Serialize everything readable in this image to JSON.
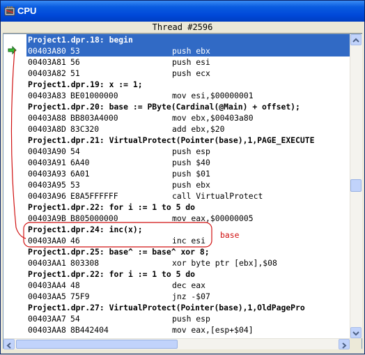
{
  "window": {
    "title": "CPU"
  },
  "thread_header": "Thread #2596",
  "annotation": {
    "label": "base",
    "color": "#d01010"
  },
  "rows": [
    {
      "kind": "src",
      "text": "Project1.dpr.18: begin",
      "selected": true
    },
    {
      "kind": "asm",
      "addr": "00403A80",
      "bytes": "53",
      "instr": "push ebx",
      "selected": true
    },
    {
      "kind": "asm",
      "addr": "00403A81",
      "bytes": "56",
      "instr": "push esi"
    },
    {
      "kind": "asm",
      "addr": "00403A82",
      "bytes": "51",
      "instr": "push ecx"
    },
    {
      "kind": "src",
      "text": "Project1.dpr.19: x := 1;"
    },
    {
      "kind": "asm",
      "addr": "00403A83",
      "bytes": "BE01000000",
      "instr": "mov esi,$00000001"
    },
    {
      "kind": "src",
      "text": "Project1.dpr.20: base := PByte(Cardinal(@Main) + offset);"
    },
    {
      "kind": "asm",
      "addr": "00403A88",
      "bytes": "BB803A4000",
      "instr": "mov ebx,$00403a80"
    },
    {
      "kind": "asm",
      "addr": "00403A8D",
      "bytes": "83C320",
      "instr": "add ebx,$20"
    },
    {
      "kind": "src",
      "text": "Project1.dpr.21: VirtualProtect(Pointer(base),1,PAGE_EXECUTE"
    },
    {
      "kind": "asm",
      "addr": "00403A90",
      "bytes": "54",
      "instr": "push esp"
    },
    {
      "kind": "asm",
      "addr": "00403A91",
      "bytes": "6A40",
      "instr": "push $40"
    },
    {
      "kind": "asm",
      "addr": "00403A93",
      "bytes": "6A01",
      "instr": "push $01"
    },
    {
      "kind": "asm",
      "addr": "00403A95",
      "bytes": "53",
      "instr": "push ebx"
    },
    {
      "kind": "asm",
      "addr": "00403A96",
      "bytes": "E8A5FFFFFF",
      "instr": "call VirtualProtect"
    },
    {
      "kind": "src",
      "text": "Project1.dpr.22: for i := 1 to 5 do"
    },
    {
      "kind": "asm",
      "addr": "00403A9B",
      "bytes": "B805000000",
      "instr": "mov eax,$00000005"
    },
    {
      "kind": "src",
      "text": "Project1.dpr.24: inc(x);"
    },
    {
      "kind": "asm",
      "addr": "00403AA0",
      "bytes": "46",
      "instr": "inc esi"
    },
    {
      "kind": "src",
      "text": "Project1.dpr.25: base^ := base^ xor 8;"
    },
    {
      "kind": "asm",
      "addr": "00403AA1",
      "bytes": "803308",
      "instr": "xor byte ptr [ebx],$08"
    },
    {
      "kind": "src",
      "text": "Project1.dpr.22: for i := 1 to 5 do"
    },
    {
      "kind": "asm",
      "addr": "00403AA4",
      "bytes": "48",
      "instr": "dec eax"
    },
    {
      "kind": "asm",
      "addr": "00403AA5",
      "bytes": "75F9",
      "instr": "jnz -$07"
    },
    {
      "kind": "src",
      "text": "Project1.dpr.27: VirtualProtect(Pointer(base),1,OldPagePro"
    },
    {
      "kind": "asm",
      "addr": "00403AA7",
      "bytes": "54",
      "instr": "push esp"
    },
    {
      "kind": "asm",
      "addr": "00403AA8",
      "bytes": "8B442404",
      "instr": "mov eax,[esp+$04]"
    }
  ]
}
